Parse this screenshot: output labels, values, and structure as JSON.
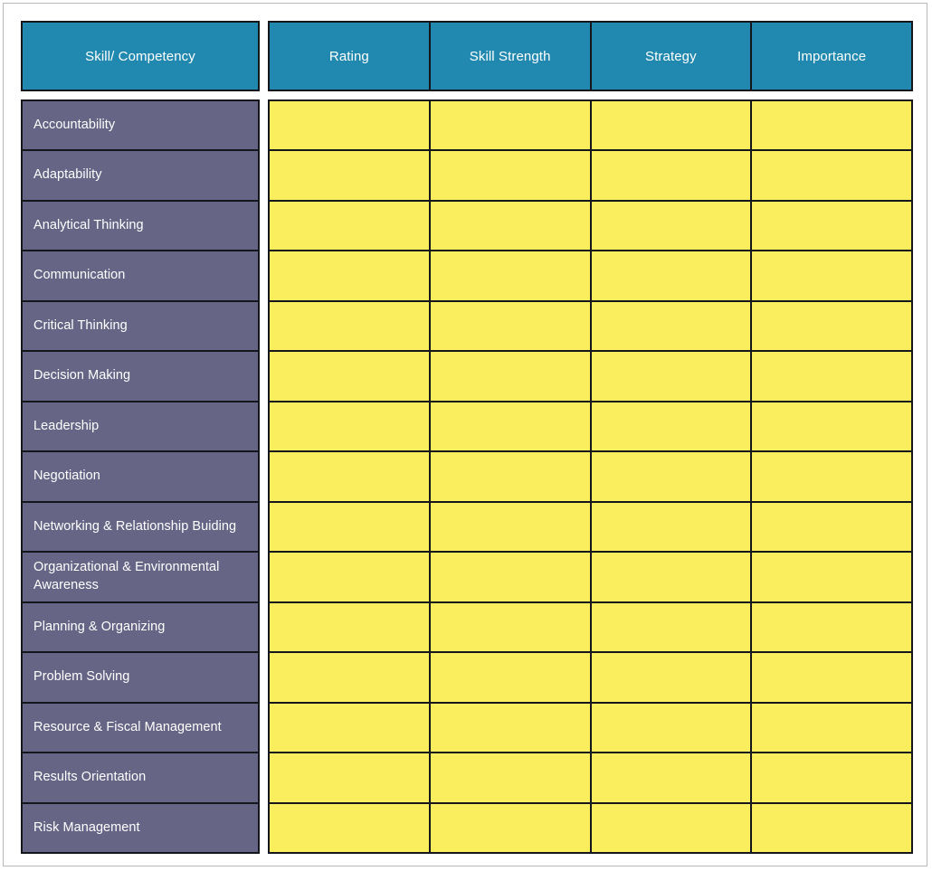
{
  "worksheet": {
    "title_column_header": "Skill/ Competency",
    "colors": {
      "header_teal": "#2189af",
      "skill_purple": "#666585",
      "cell_yellow": "#fbee5e",
      "border_black": "#14161c",
      "text_white": "#ffffff",
      "page_border": "#b8b8b8",
      "background": "#ffffff"
    },
    "column_headers": [
      "Rating",
      "Skill Strength",
      "Strategy",
      "Importance"
    ],
    "rows": [
      {
        "skill": "Accountability",
        "rating": "",
        "skill_strength": "",
        "strategy": "",
        "importance": ""
      },
      {
        "skill": "Adaptability",
        "rating": "",
        "skill_strength": "",
        "strategy": "",
        "importance": ""
      },
      {
        "skill": "Analytical Thinking",
        "rating": "",
        "skill_strength": "",
        "strategy": "",
        "importance": ""
      },
      {
        "skill": "Communication",
        "rating": "",
        "skill_strength": "",
        "strategy": "",
        "importance": ""
      },
      {
        "skill": "Critical Thinking",
        "rating": "",
        "skill_strength": "",
        "strategy": "",
        "importance": ""
      },
      {
        "skill": "Decision Making",
        "rating": "",
        "skill_strength": "",
        "strategy": "",
        "importance": ""
      },
      {
        "skill": "Leadership",
        "rating": "",
        "skill_strength": "",
        "strategy": "",
        "importance": ""
      },
      {
        "skill": "Negotiation",
        "rating": "",
        "skill_strength": "",
        "strategy": "",
        "importance": ""
      },
      {
        "skill": "Networking & Relationship Buiding",
        "rating": "",
        "skill_strength": "",
        "strategy": "",
        "importance": ""
      },
      {
        "skill": "Organizational & Environmental Awareness",
        "rating": "",
        "skill_strength": "",
        "strategy": "",
        "importance": ""
      },
      {
        "skill": "Planning & Organizing",
        "rating": "",
        "skill_strength": "",
        "strategy": "",
        "importance": ""
      },
      {
        "skill": "Problem Solving",
        "rating": "",
        "skill_strength": "",
        "strategy": "",
        "importance": ""
      },
      {
        "skill": "Resource & Fiscal Management",
        "rating": "",
        "skill_strength": "",
        "strategy": "",
        "importance": ""
      },
      {
        "skill": "Results Orientation",
        "rating": "",
        "skill_strength": "",
        "strategy": "",
        "importance": ""
      },
      {
        "skill": "Risk Management",
        "rating": "",
        "skill_strength": "",
        "strategy": "",
        "importance": ""
      }
    ]
  }
}
